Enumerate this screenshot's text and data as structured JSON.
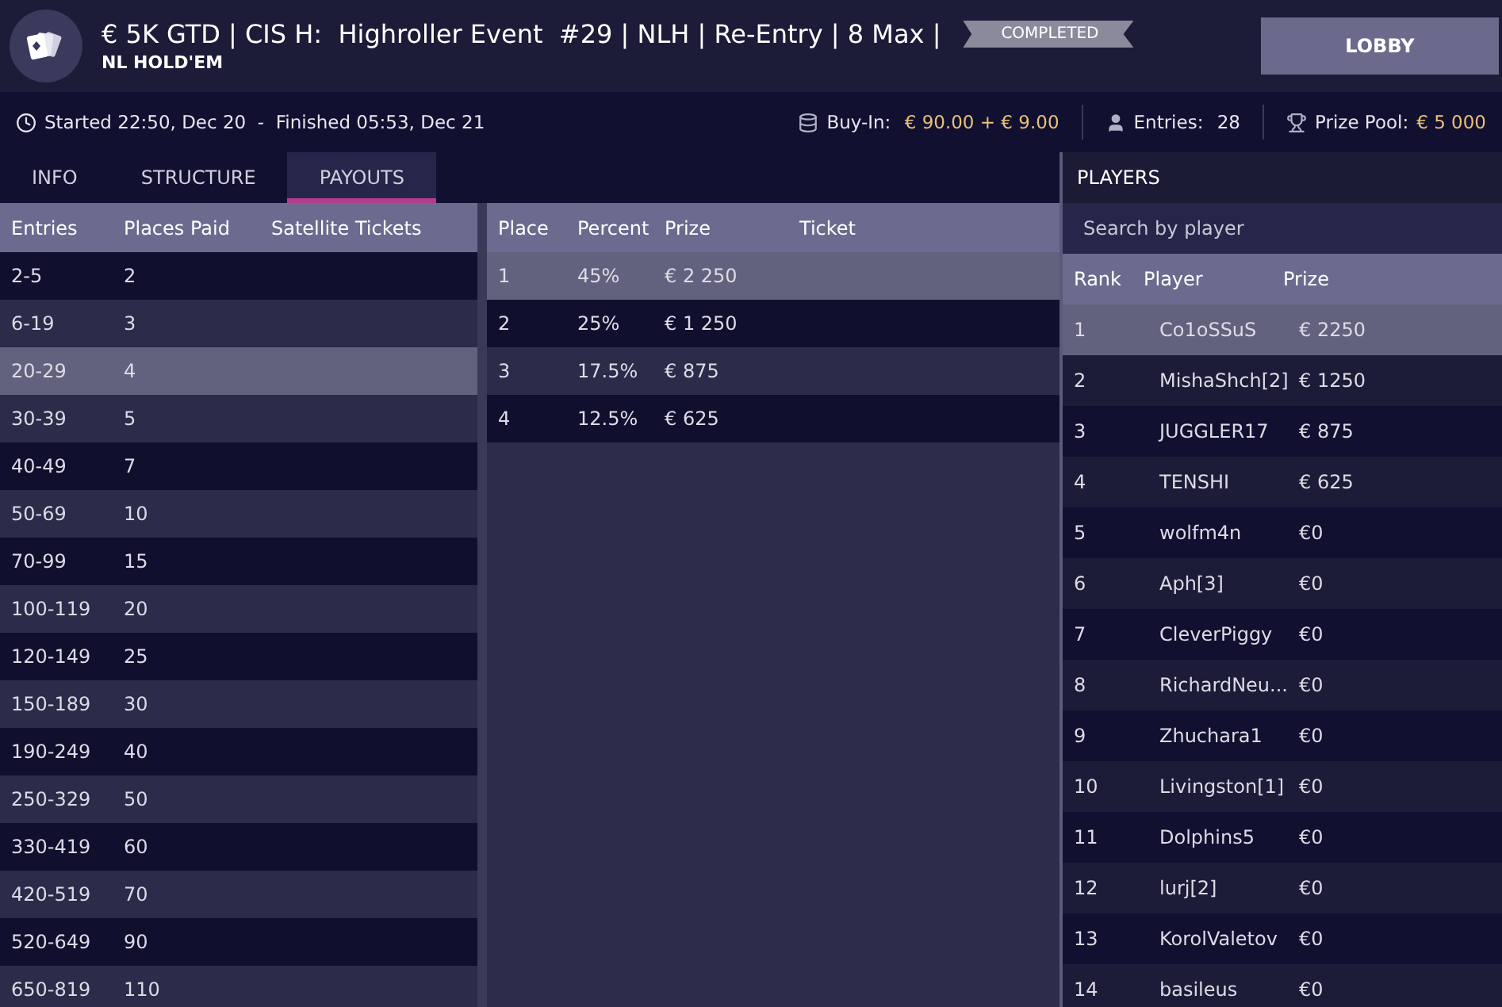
{
  "header": {
    "title": "€ 5K GTD | CIS H:  Highroller Event  #29 | NLH | Re-Entry | 8 Max |",
    "subtitle": "NL HOLD'EM",
    "status": "COMPLETED",
    "lobby_button": "LOBBY"
  },
  "info_bar": {
    "times": "Started 22:50, Dec 20  -  Finished 05:53, Dec 21",
    "buy_in_label": "Buy-In:",
    "buy_in": "€ 90.00 + € 9.00",
    "entries_label": "Entries:",
    "entries": "28",
    "prize_pool_label": "Prize Pool:",
    "prize_pool": "€ 5 000"
  },
  "tabs": [
    {
      "label": "INFO",
      "selected": false
    },
    {
      "label": "STRUCTURE",
      "selected": false
    },
    {
      "label": "PAYOUTS",
      "selected": true
    }
  ],
  "entries_table": {
    "columns": [
      "Entries",
      "Places Paid",
      "Satellite Tickets"
    ],
    "rows": [
      {
        "entries": "2-5",
        "places": "2",
        "selected": false
      },
      {
        "entries": "6-19",
        "places": "3",
        "selected": false
      },
      {
        "entries": "20-29",
        "places": "4",
        "selected": true
      },
      {
        "entries": "30-39",
        "places": "5",
        "selected": false
      },
      {
        "entries": "40-49",
        "places": "7",
        "selected": false
      },
      {
        "entries": "50-69",
        "places": "10",
        "selected": false
      },
      {
        "entries": "70-99",
        "places": "15",
        "selected": false
      },
      {
        "entries": "100-119",
        "places": "20",
        "selected": false
      },
      {
        "entries": "120-149",
        "places": "25",
        "selected": false
      },
      {
        "entries": "150-189",
        "places": "30",
        "selected": false
      },
      {
        "entries": "190-249",
        "places": "40",
        "selected": false
      },
      {
        "entries": "250-329",
        "places": "50",
        "selected": false
      },
      {
        "entries": "330-419",
        "places": "60",
        "selected": false
      },
      {
        "entries": "420-519",
        "places": "70",
        "selected": false
      },
      {
        "entries": "520-649",
        "places": "90",
        "selected": false
      },
      {
        "entries": "650-819",
        "places": "110",
        "selected": false
      }
    ]
  },
  "payouts_table": {
    "columns": [
      "Place",
      "Percent",
      "Prize",
      "Ticket"
    ],
    "rows": [
      {
        "place": "1",
        "percent": "45%",
        "prize": "€ 2 250",
        "selected": true
      },
      {
        "place": "2",
        "percent": "25%",
        "prize": "€ 1 250",
        "selected": false
      },
      {
        "place": "3",
        "percent": "17.5%",
        "prize": "€ 875",
        "selected": false
      },
      {
        "place": "4",
        "percent": "12.5%",
        "prize": "€ 625",
        "selected": false
      }
    ]
  },
  "players": {
    "title": "PLAYERS",
    "search": {
      "placeholder": "Search by player"
    },
    "columns": [
      "Rank",
      "Player",
      "Prize"
    ],
    "rows": [
      {
        "rank": "1",
        "player": "Co1oSSuS",
        "prize": "€ 2250",
        "selected": true
      },
      {
        "rank": "2",
        "player": "MishaShch[2]",
        "prize": "€ 1250",
        "selected": false
      },
      {
        "rank": "3",
        "player": "JUGGLER17",
        "prize": "€ 875",
        "selected": false
      },
      {
        "rank": "4",
        "player": "TENSHI",
        "prize": "€ 625",
        "selected": false
      },
      {
        "rank": "5",
        "player": "wolfm4n",
        "prize": "€0",
        "selected": false
      },
      {
        "rank": "6",
        "player": "Aph[3]",
        "prize": "€0",
        "selected": false
      },
      {
        "rank": "7",
        "player": "CleverPiggy",
        "prize": "€0",
        "selected": false
      },
      {
        "rank": "8",
        "player": "RichardNeu...",
        "prize": "€0",
        "selected": false
      },
      {
        "rank": "9",
        "player": "Zhuchara1",
        "prize": "€0",
        "selected": false
      },
      {
        "rank": "10",
        "player": "Livingston[1]",
        "prize": "€0",
        "selected": false
      },
      {
        "rank": "11",
        "player": "Dolphins5",
        "prize": "€0",
        "selected": false
      },
      {
        "rank": "12",
        "player": "lurj[2]",
        "prize": "€0",
        "selected": false
      },
      {
        "rank": "13",
        "player": "KorolValetov",
        "prize": "€0",
        "selected": false
      },
      {
        "rank": "14",
        "player": "basileus",
        "prize": "€0",
        "selected": false
      }
    ]
  }
}
